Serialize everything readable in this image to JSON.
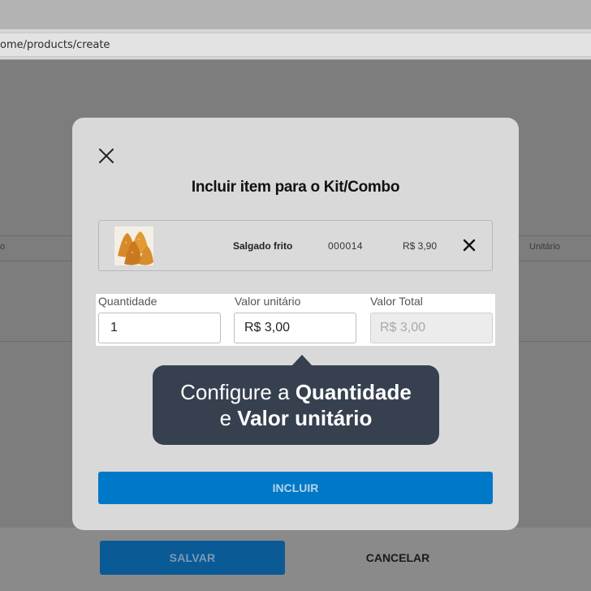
{
  "browser": {
    "address": "ome/products/create"
  },
  "background_page": {
    "table_col_left": "o",
    "table_col_right": "Unitário",
    "save_label": "SALVAR",
    "cancel_label": "CANCELAR"
  },
  "modal": {
    "title": "Incluir item para o Kit/Combo",
    "item": {
      "name": "Salgado frito",
      "code": "000014",
      "price": "R$ 3,90"
    },
    "fields": {
      "quantity_label": "Quantidade",
      "quantity_value": "1",
      "unit_value_label": "Valor unitário",
      "unit_value_value": "R$ 3,00",
      "total_label": "Valor Total",
      "total_value": "R$ 3,00"
    },
    "tooltip": {
      "line1_prefix": "Configure a ",
      "line1_bold": "Quantidade",
      "line2_prefix": "e ",
      "line2_bold": "Valor unitário"
    },
    "include_label": "INCLUIR"
  },
  "colors": {
    "primary": "#0078c8",
    "tooltip_bg": "#36404f",
    "overlay": "#808080"
  },
  "icons": [
    "close-icon",
    "remove-item-icon",
    "coxinha-thumbnail"
  ]
}
